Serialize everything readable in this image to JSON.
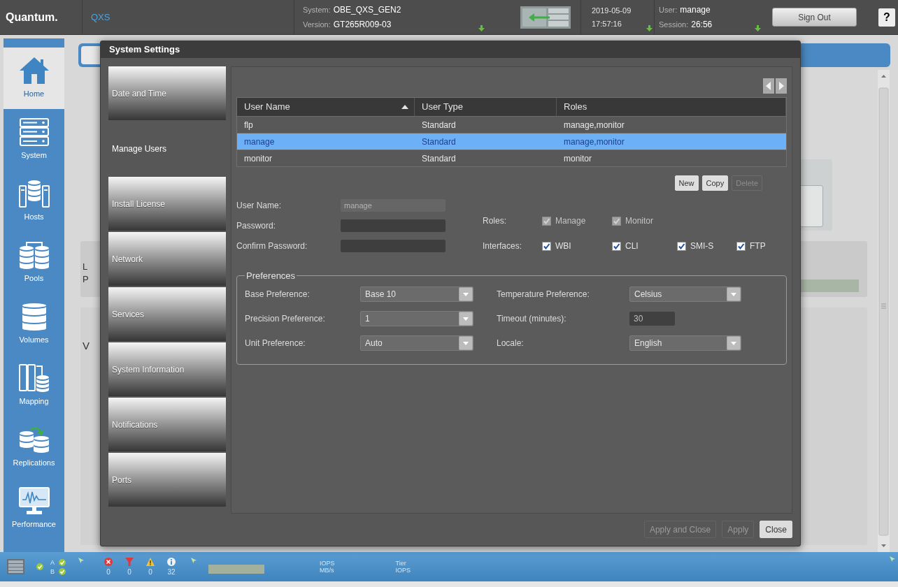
{
  "header": {
    "logo": "Quantum.",
    "product": "QXS",
    "system": [
      {
        "label": "System:",
        "value": "OBE_QXS_GEN2"
      },
      {
        "label": "Version:",
        "value": "GT265R009-03"
      }
    ],
    "clock": [
      "2019-05-09",
      "17:57:16"
    ],
    "session": [
      {
        "label": "User:",
        "value": "manage"
      },
      {
        "label": "Session:",
        "value": "26:56"
      }
    ],
    "sign_out": "Sign Out",
    "help": "?"
  },
  "nav": [
    {
      "label": "Home",
      "selected": true
    },
    {
      "label": "System",
      "selected": false
    },
    {
      "label": "Hosts",
      "selected": false
    },
    {
      "label": "Pools",
      "selected": false
    },
    {
      "label": "Volumes",
      "selected": false
    },
    {
      "label": "Mapping",
      "selected": false
    },
    {
      "label": "Replications",
      "selected": false
    },
    {
      "label": "Performance",
      "selected": false
    }
  ],
  "background": {
    "panels": [
      [
        "L",
        "P"
      ],
      [
        "V"
      ]
    ]
  },
  "dialog": {
    "title": "System Settings",
    "tabs": [
      {
        "label": "Date and Time",
        "selected": false
      },
      {
        "label": "Manage Users",
        "selected": true
      },
      {
        "label": "Install License",
        "selected": false
      },
      {
        "label": "Network",
        "selected": false
      },
      {
        "label": "Services",
        "selected": false
      },
      {
        "label": "System Information",
        "selected": false
      },
      {
        "label": "Notifications",
        "selected": false
      },
      {
        "label": "Ports",
        "selected": false
      }
    ],
    "table": {
      "columns": [
        {
          "label": "User Name",
          "sorted": true
        },
        {
          "label": "User Type",
          "sorted": false
        },
        {
          "label": "Roles",
          "sorted": false
        }
      ],
      "rows": [
        {
          "cells": [
            "flp",
            "Standard",
            "manage,monitor"
          ],
          "selected": false
        },
        {
          "cells": [
            "manage",
            "Standard",
            "manage,monitor"
          ],
          "selected": true
        },
        {
          "cells": [
            "monitor",
            "Standard",
            "monitor"
          ],
          "selected": false
        }
      ]
    },
    "table_buttons": [
      {
        "label": "New",
        "disabled": false
      },
      {
        "label": "Copy",
        "disabled": false
      },
      {
        "label": "Delete",
        "disabled": true
      }
    ],
    "account_fields": [
      {
        "label": "User Name:",
        "value": "manage",
        "disabled": true
      },
      {
        "label": "Password:",
        "disabled": false
      },
      {
        "label": "Confirm Password:",
        "disabled": false
      }
    ],
    "roles": {
      "label": "Roles:",
      "options": [
        {
          "label": "Manage",
          "checked": true,
          "disabled": true
        },
        {
          "label": "Monitor",
          "checked": true,
          "disabled": true
        }
      ]
    },
    "interfaces": {
      "label": "Interfaces:",
      "options": [
        {
          "label": "WBI",
          "checked": true,
          "disabled": false
        },
        {
          "label": "CLI",
          "checked": true,
          "disabled": false
        },
        {
          "label": "SMI-S",
          "checked": true,
          "disabled": false
        },
        {
          "label": "FTP",
          "checked": true,
          "disabled": false
        }
      ]
    },
    "preferences": {
      "legend": "Preferences",
      "items": [
        {
          "label": "Base Preference:",
          "kind": "select",
          "value": "Base 10"
        },
        {
          "label": "Temperature Preference:",
          "kind": "select",
          "value": "Celsius"
        },
        {
          "label": "Precision Preference:",
          "kind": "select",
          "value": "1"
        },
        {
          "label": "Timeout (minutes):",
          "kind": "input",
          "value": "30"
        },
        {
          "label": "Unit Preference:",
          "kind": "select",
          "value": "Auto"
        },
        {
          "label": "Locale:",
          "kind": "select",
          "value": "English"
        }
      ]
    },
    "buttons": [
      {
        "label": "Apply and Close",
        "disabled": true
      },
      {
        "label": "Apply",
        "disabled": true
      },
      {
        "label": "Close",
        "disabled": false
      }
    ]
  },
  "status_bar": {
    "controllers": [
      "A",
      "B"
    ],
    "alerts": [
      {
        "kind": "critical",
        "count": "0"
      },
      {
        "kind": "error",
        "count": "0"
      },
      {
        "kind": "warning",
        "count": "0"
      },
      {
        "kind": "info",
        "count": "32"
      }
    ],
    "meters": [
      [
        "IOPS",
        "MB/s"
      ],
      [
        "Tier",
        "IOPS"
      ]
    ]
  }
}
